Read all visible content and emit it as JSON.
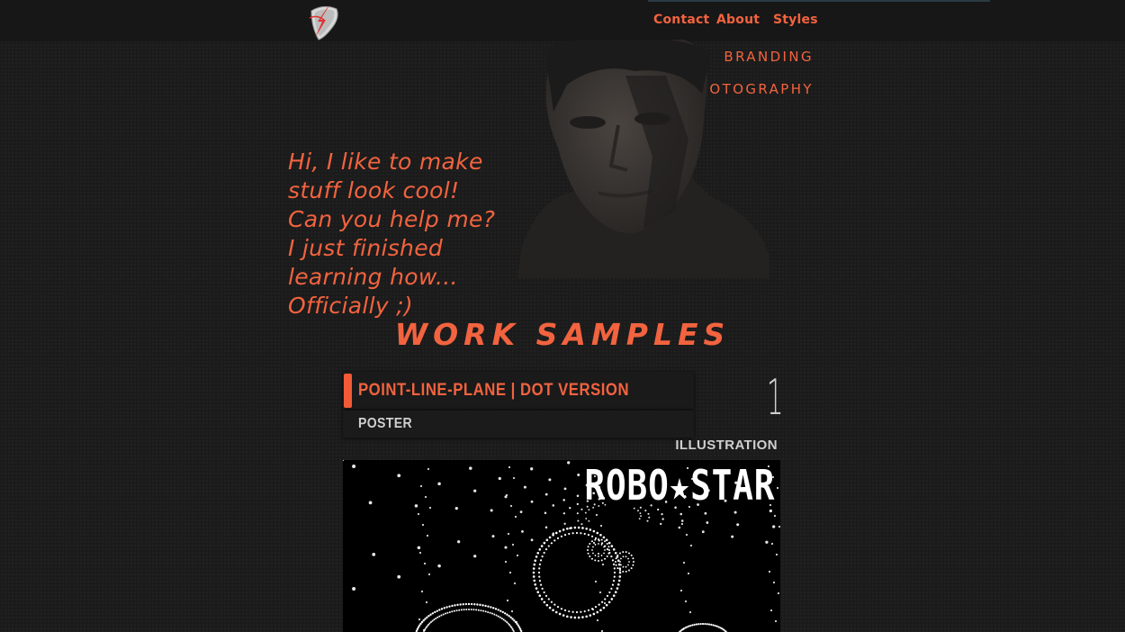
{
  "nav": {
    "items": [
      "Contact",
      "About",
      "Styles"
    ],
    "sub_items": [
      "BRANDING",
      "PHOTOGRAPHY"
    ]
  },
  "logo": {
    "icon": "lightning-guitar-pick-logo"
  },
  "intro": {
    "text": "Hi, I like to make stuff look cool! Can you help me? I just finished learning how... Officially ;)"
  },
  "section": {
    "title": "WORK SAMPLES"
  },
  "work": {
    "title": "POINT-LINE-PLANE | DOT VERSION",
    "subtitle": "POSTER",
    "number": "1",
    "category": "ILLUSTRATION",
    "poster_title": "ROBO★STAR"
  },
  "colors": {
    "accent": "#f2633f",
    "background": "#1b1b1b",
    "text_light": "#cfcfcf"
  }
}
